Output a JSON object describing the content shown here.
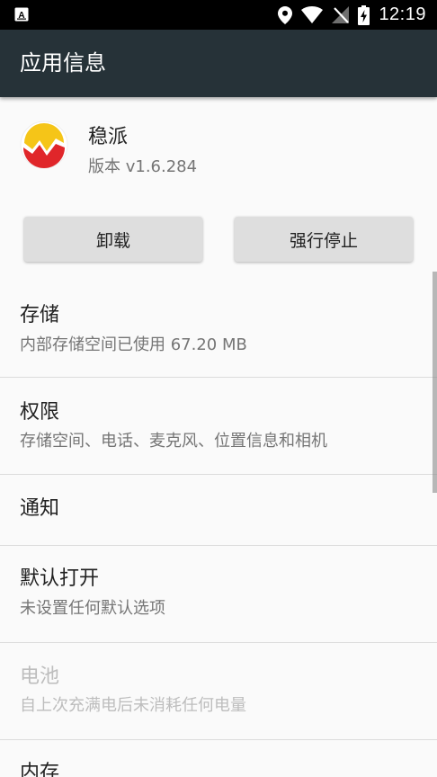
{
  "status_bar": {
    "time": "12:19",
    "left_icon": "a-box-icon",
    "icons": [
      "location-icon",
      "wifi-icon",
      "no-signal-icon",
      "battery-charging-icon"
    ]
  },
  "toolbar": {
    "title": "应用信息"
  },
  "app": {
    "name": "稳派",
    "version": "版本 v1.6.284",
    "icon": "app-logo-icon"
  },
  "buttons": {
    "uninstall": "卸载",
    "force_stop": "强行停止"
  },
  "settings": {
    "storage": {
      "title": "存储",
      "summary": "内部存储空间已使用 67.20 MB"
    },
    "permissions": {
      "title": "权限",
      "summary": "存储空间、电话、麦克风、位置信息和相机"
    },
    "notifications": {
      "title": "通知"
    },
    "open_by_default": {
      "title": "默认打开",
      "summary": "未设置任何默认选项"
    },
    "battery": {
      "title": "电池",
      "summary": "自上次充满电后未消耗任何电量"
    },
    "memory": {
      "title": "内存"
    }
  },
  "colors": {
    "toolbar": "#263238",
    "status_bar": "#000000",
    "background": "#fafafa",
    "button": "#dedede"
  }
}
